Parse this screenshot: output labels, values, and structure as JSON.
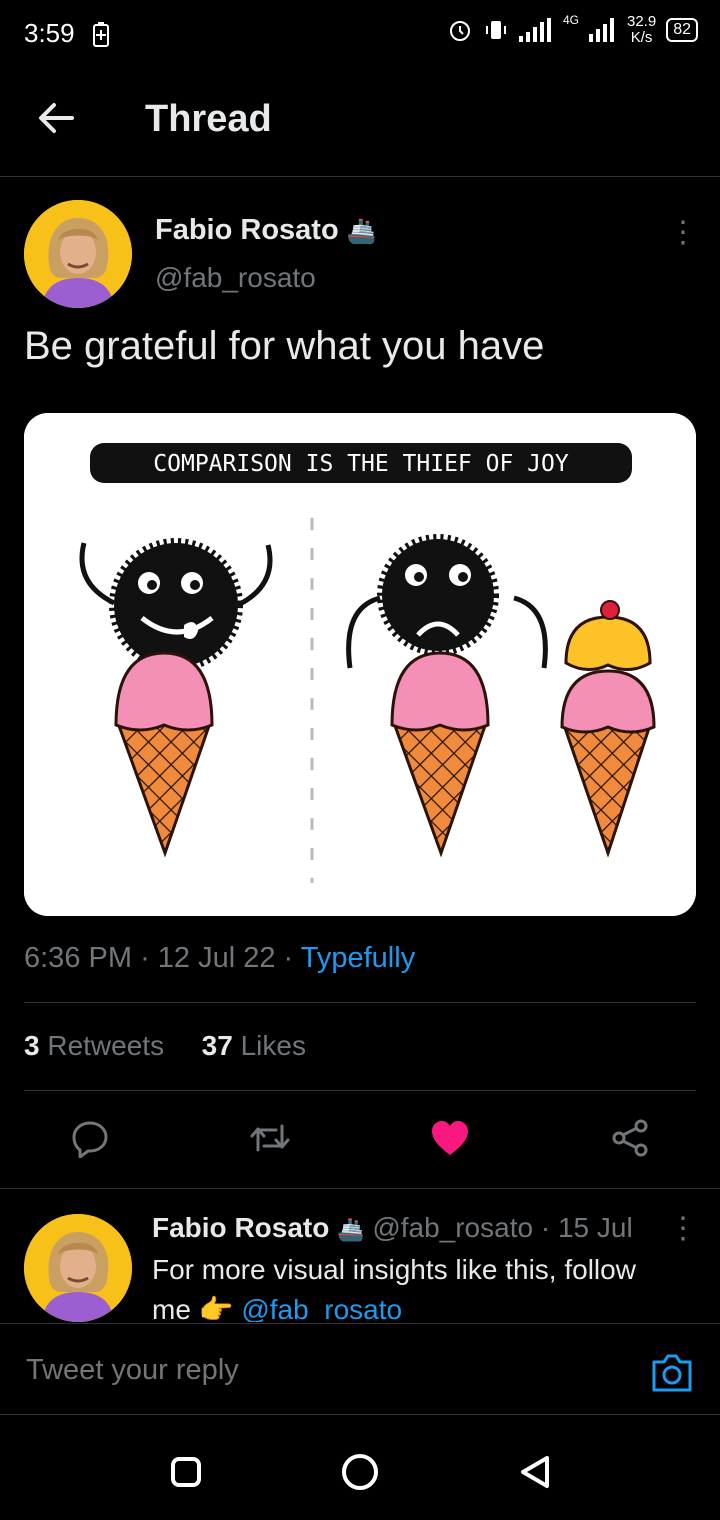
{
  "status_bar": {
    "time": "3:59",
    "network": "4G",
    "speed_value": "32.9",
    "speed_unit": "K/s",
    "battery": "82"
  },
  "header": {
    "title": "Thread"
  },
  "tweet": {
    "author_name": "Fabio Rosato",
    "author_emoji": "🚢",
    "author_handle": "@fab_rosato",
    "text": "Be grateful for what you have",
    "image_caption": "COMPARISON IS THE THIEF OF JOY",
    "time": "6:36 PM",
    "date": "12 Jul 22",
    "source": "Typefully",
    "retweets_count": "3",
    "retweets_label": "Retweets",
    "likes_count": "37",
    "likes_label": "Likes",
    "liked": true
  },
  "reply": {
    "author_name": "Fabio Rosato",
    "author_emoji": "🚢",
    "author_handle": "@fab_rosato",
    "date": "15 Jul",
    "text_line1": "For more visual insights like this, follow",
    "text_me": "me",
    "pointing_emoji": "👉",
    "mention": "@fab_rosato"
  },
  "compose": {
    "placeholder": "Tweet your reply"
  },
  "colors": {
    "accent": "#1d9bf0",
    "like": "#f91880",
    "background": "#000000",
    "avatar_bg": "#f7c11a"
  },
  "icons": [
    "back-arrow-icon",
    "more-icon",
    "reply-icon",
    "retweet-icon",
    "like-icon",
    "share-icon",
    "camera-icon",
    "recent-apps-icon",
    "home-icon",
    "back-icon"
  ]
}
